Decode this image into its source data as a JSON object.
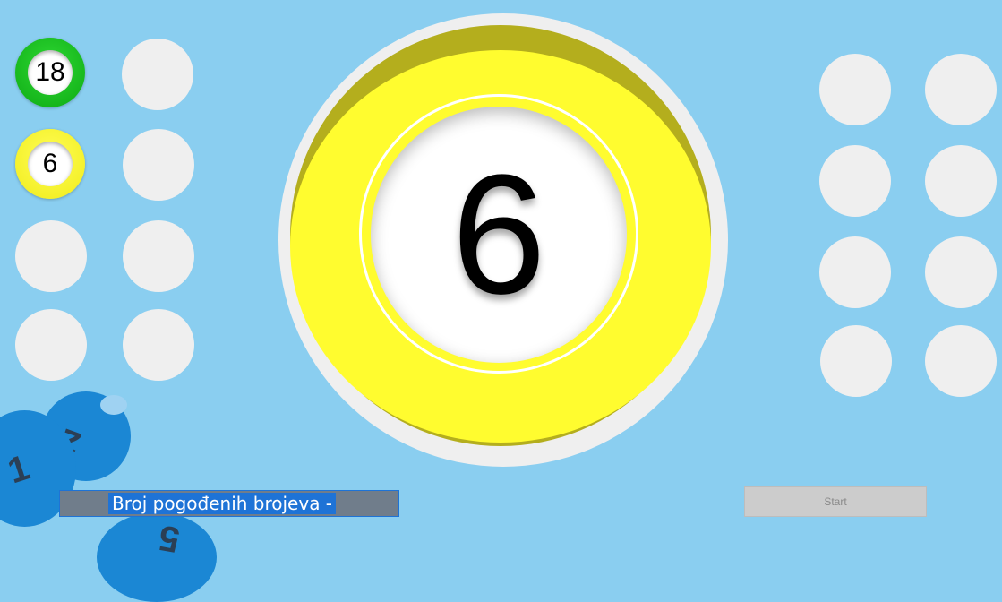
{
  "drawn_balls": [
    {
      "number": "18",
      "color": "#13C21B"
    },
    {
      "number": "6",
      "color": "#FFFC2F"
    }
  ],
  "current_ball": {
    "number": "6",
    "color": "#FFFC2F"
  },
  "status": {
    "text": "Broj pogođenih brojeva - "
  },
  "start_button": {
    "label": "Start"
  },
  "decor_balls": [
    "1",
    "2",
    "5"
  ],
  "colors": {
    "background": "#8ACEF0",
    "slot": "#EFEFEF",
    "deco_ball": "#1B87D4"
  }
}
